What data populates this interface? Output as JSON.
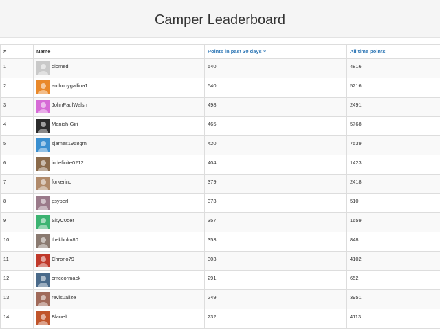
{
  "header": {
    "title": "Camper Leaderboard"
  },
  "table": {
    "columns": {
      "rank": "#",
      "name": "Name",
      "recent": "Points in past 30 days ˅",
      "alltime": "All time points"
    },
    "rows": [
      {
        "rank": "1",
        "name": "diomed",
        "recent": "540",
        "alltime": "4816",
        "avatar": "avatar-diomed",
        "avatar_color": "#c9c9c9"
      },
      {
        "rank": "2",
        "name": "anthonygallina1",
        "recent": "540",
        "alltime": "5216",
        "avatar": "avatar-anthonygallina1",
        "avatar_color": "#e9892b"
      },
      {
        "rank": "3",
        "name": "JohnPaulWalsh",
        "recent": "498",
        "alltime": "2491",
        "avatar": "avatar-johnpaulwalsh",
        "avatar_color": "#d66bd6"
      },
      {
        "rank": "4",
        "name": "Manish-Giri",
        "recent": "465",
        "alltime": "5768",
        "avatar": "avatar-manish-giri",
        "avatar_color": "#2b2b2b"
      },
      {
        "rank": "5",
        "name": "sjames1958gm",
        "recent": "420",
        "alltime": "7539",
        "avatar": "avatar-sjames1958gm",
        "avatar_color": "#3a8fd0"
      },
      {
        "rank": "6",
        "name": "indefinite0212",
        "recent": "404",
        "alltime": "1423",
        "avatar": "avatar-indefinite0212",
        "avatar_color": "#8a6a4a"
      },
      {
        "rank": "7",
        "name": "forkerino",
        "recent": "379",
        "alltime": "2418",
        "avatar": "avatar-forkerino",
        "avatar_color": "#b08a6a"
      },
      {
        "rank": "8",
        "name": "psyperl",
        "recent": "373",
        "alltime": "510",
        "avatar": "avatar-psyperl",
        "avatar_color": "#9a7a8a"
      },
      {
        "rank": "9",
        "name": "SkyC0der",
        "recent": "357",
        "alltime": "1659",
        "avatar": "avatar-skyc0der",
        "avatar_color": "#3cb371"
      },
      {
        "rank": "10",
        "name": "thekholm80",
        "recent": "353",
        "alltime": "848",
        "avatar": "avatar-thekholm80",
        "avatar_color": "#8a7a70"
      },
      {
        "rank": "11",
        "name": "Chrono79",
        "recent": "303",
        "alltime": "4102",
        "avatar": "avatar-chrono79",
        "avatar_color": "#c0392b"
      },
      {
        "rank": "12",
        "name": "cmccormack",
        "recent": "291",
        "alltime": "652",
        "avatar": "avatar-cmccormack",
        "avatar_color": "#4a6a8a"
      },
      {
        "rank": "13",
        "name": "revisualize",
        "recent": "249",
        "alltime": "3951",
        "avatar": "avatar-revisualize",
        "avatar_color": "#a06a5a"
      },
      {
        "rank": "14",
        "name": "Blauelf",
        "recent": "232",
        "alltime": "4113",
        "avatar": "avatar-blauelf",
        "avatar_color": "#c0552b"
      }
    ]
  }
}
